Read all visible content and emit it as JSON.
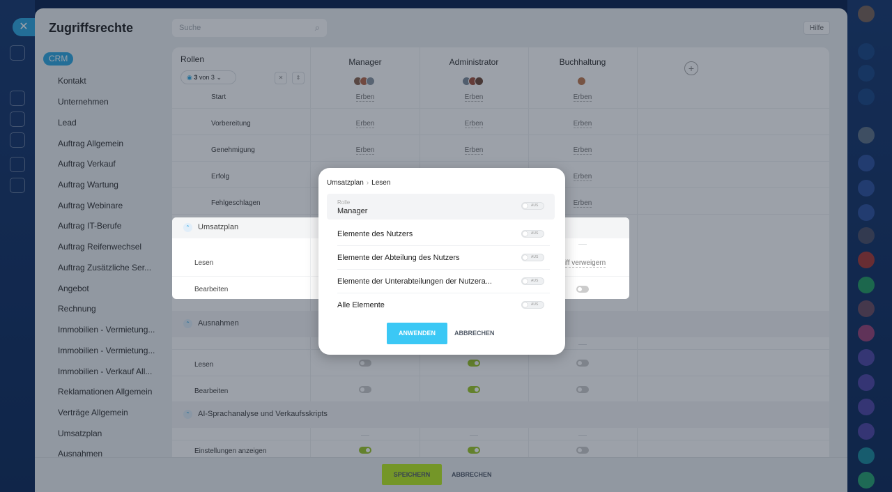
{
  "panel": {
    "title": "Zugriffsrechte",
    "search_placeholder": "Suche",
    "help_label": "Hilfe",
    "crm_badge": "CRM"
  },
  "sidebar": {
    "items": [
      "Kontakt",
      "Unternehmen",
      "Lead",
      "Auftrag Allgemein",
      "Auftrag Verkauf",
      "Auftrag Wartung",
      "Auftrag Webinare",
      "Auftrag IT-Berufe",
      "Auftrag Reifenwechsel",
      "Auftrag Zusätzliche Ser...",
      "Angebot",
      "Rechnung",
      "Immobilien - Vermietung...",
      "Immobilien - Vermietung...",
      "Immobilien - Verkauf All...",
      "Reklamationen Allgemein",
      "Verträge Allgemein",
      "Umsatzplan",
      "Ausnahmen"
    ]
  },
  "table": {
    "roles_label": "Rollen",
    "visible_count": "3",
    "visible_of": "von 3",
    "columns": [
      "Manager",
      "Administrator",
      "Buchhaltung"
    ],
    "inherit_label": "Erben",
    "stage_rows": [
      "Start",
      "Vorbereitung",
      "Genehmigung",
      "Erfolg",
      "Fehlgeschlagen"
    ],
    "sections": [
      {
        "title": "Umsatzplan",
        "rows": [
          "Lesen",
          "Bearbeiten"
        ]
      },
      {
        "title": "Ausnahmen",
        "rows": [
          "Lesen",
          "Bearbeiten"
        ]
      },
      {
        "title": "AI-Sprachanalyse und Verkaufsskripts",
        "rows": [
          "Einstellungen anzeigen"
        ]
      }
    ],
    "deny_text": "griff verweigern",
    "toggles": {
      "ausnahmen_lesen": [
        "off",
        "on",
        "off"
      ],
      "ausnahmen_bearbeiten": [
        "off",
        "on",
        "off"
      ],
      "ai_einstellungen": [
        "on",
        "on",
        "off"
      ],
      "umsatzplan_bearbeiten_buchhaltung": "off"
    }
  },
  "footer": {
    "save_label": "SPEICHERN",
    "cancel_label": "ABBRECHEN"
  },
  "popup": {
    "breadcrumb": [
      "Umsatzplan",
      "Lesen"
    ],
    "role_caption": "Rolle",
    "role_value": "Manager",
    "switch_text": "AUS",
    "options": [
      "Elemente des Nutzers",
      "Elemente der Abteilung des Nutzers",
      "Elemente der Unterabteilungen der Nutzera...",
      "Alle Elemente"
    ],
    "apply_label": "ANWENDEN",
    "cancel_label": "ABBRECHEN"
  },
  "colors": {
    "accent": "#2fa8e0",
    "save": "#bbed21",
    "toggle_on": "#9dc828",
    "apply": "#3bc8f5"
  }
}
